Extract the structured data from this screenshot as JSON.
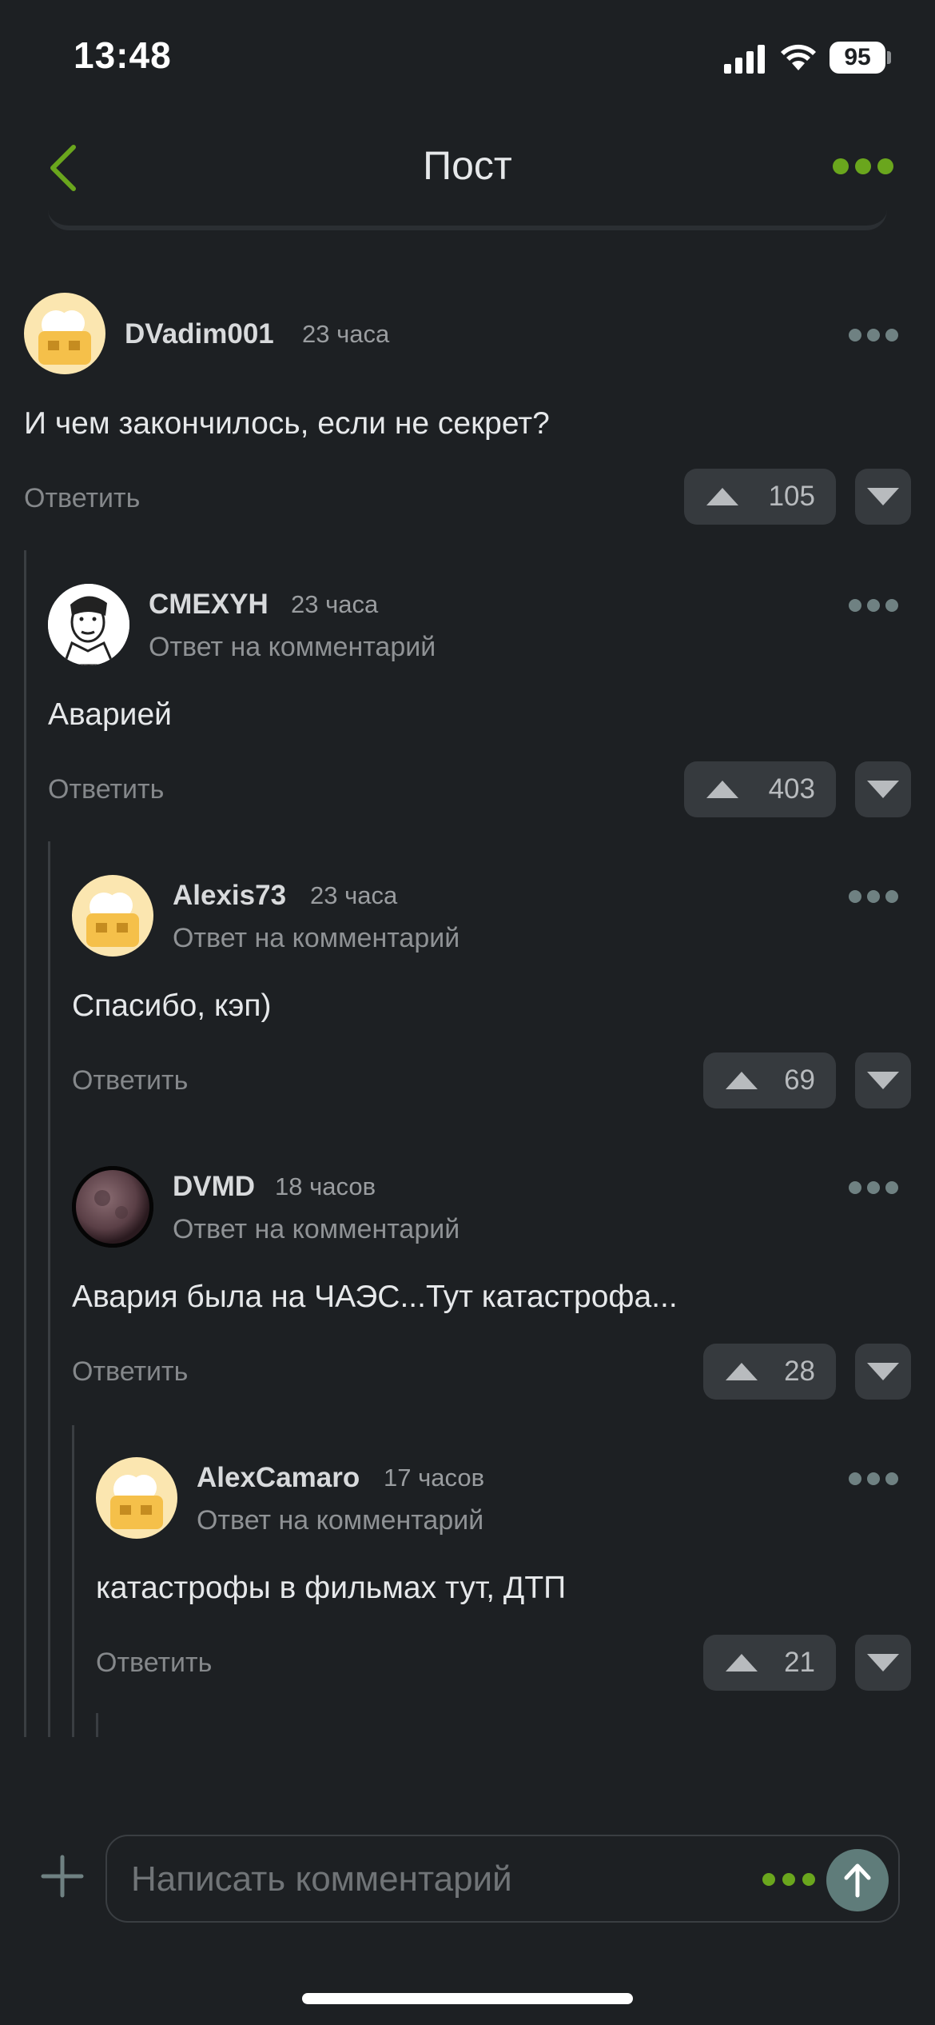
{
  "status_bar": {
    "time": "13:48",
    "battery": "95"
  },
  "header": {
    "title": "Пост"
  },
  "colors": {
    "accent": "#6aa61d",
    "background": "#1d2023",
    "vote_bg": "#363a3e"
  },
  "comments": [
    {
      "author": "DVadim001",
      "ago": "23 часа",
      "subtitle": "",
      "text": "И чем закончилось, если не секрет?",
      "reply_label": "Ответить",
      "votes": "105",
      "avatar": "cheese-avatar"
    },
    {
      "author": "CMEXYH",
      "ago": "23 часа",
      "subtitle": "Ответ на комментарий",
      "text": "Аварией",
      "reply_label": "Ответить",
      "votes": "403",
      "avatar": "meme-face-avatar"
    },
    {
      "author": "Alexis73",
      "ago": "23 часа",
      "subtitle": "Ответ на комментарий",
      "text": "Спасибо, кэп)",
      "reply_label": "Ответить",
      "votes": "69",
      "avatar": "cheese-avatar"
    },
    {
      "author": "DVMD",
      "ago": "18 часов",
      "subtitle": "Ответ на комментарий",
      "text": "Авария была на ЧАЭС...Тут катастрофа...",
      "reply_label": "Ответить",
      "votes": "28",
      "avatar": "moon-avatar"
    },
    {
      "author": "AlexCamaro",
      "ago": "17 часов",
      "subtitle": "Ответ на комментарий",
      "text": "катастрофы в фильмах тут, ДТП",
      "reply_label": "Ответить",
      "votes": "21",
      "avatar": "cheese-avatar"
    }
  ],
  "composer": {
    "placeholder": "Написать комментарий"
  }
}
